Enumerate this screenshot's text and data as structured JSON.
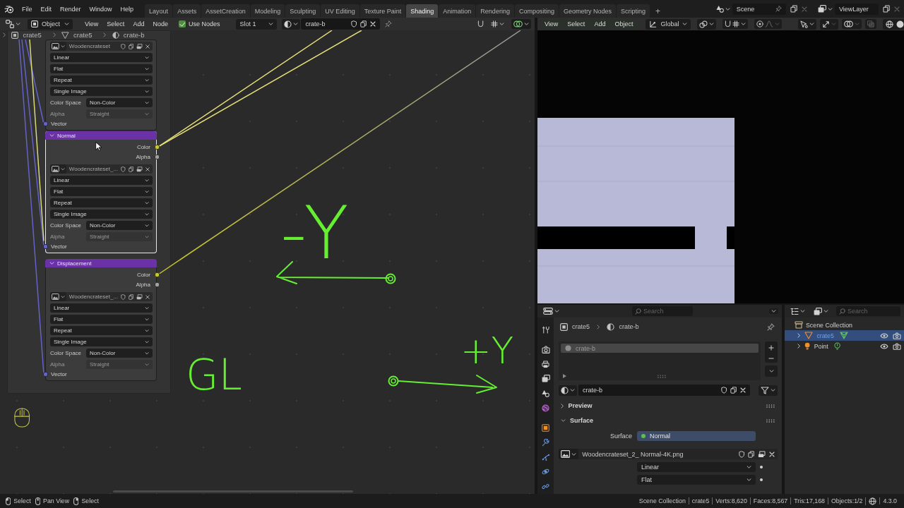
{
  "menu_bar": {
    "menus": [
      "File",
      "Edit",
      "Render",
      "Window",
      "Help"
    ],
    "workspaces": [
      {
        "label": "Layout",
        "selected": false
      },
      {
        "label": "Assets",
        "selected": false
      },
      {
        "label": "AssetCreation",
        "selected": false
      },
      {
        "label": "Modeling",
        "selected": false
      },
      {
        "label": "Sculpting",
        "selected": false
      },
      {
        "label": "UV Editing",
        "selected": false
      },
      {
        "label": "Texture Paint",
        "selected": false
      },
      {
        "label": "Shading",
        "selected": true
      },
      {
        "label": "Animation",
        "selected": false
      },
      {
        "label": "Rendering",
        "selected": false
      },
      {
        "label": "Compositing",
        "selected": false
      },
      {
        "label": "Geometry Nodes",
        "selected": false
      },
      {
        "label": "Scripting",
        "selected": false
      }
    ],
    "add_workspace": "+",
    "scene": "Scene",
    "view_layer": "ViewLayer"
  },
  "node_editor": {
    "header": {
      "mode": "Object",
      "menus": [
        "View",
        "Select",
        "Add",
        "Node"
      ],
      "use_nodes": {
        "label": "Use Nodes",
        "checked": true
      },
      "slot": "Slot 1",
      "material": "crate-b"
    },
    "breadcrumbs": [
      {
        "kind": "object",
        "label": "crate5"
      },
      {
        "kind": "mesh",
        "label": "crate5"
      },
      {
        "kind": "material",
        "label": "crate-b"
      }
    ],
    "nodes": [
      {
        "selected": false,
        "image": "Woodencrateset",
        "options": [
          "Linear",
          "Flat",
          "Repeat",
          "Single Image"
        ],
        "color_space": {
          "label": "Color Space",
          "value": "Non-Color"
        },
        "alpha": {
          "label": "Alpha",
          "value": "Straight",
          "disabled": true
        },
        "input": {
          "label": "Vector",
          "kind": "vector"
        }
      },
      {
        "title": "Normal",
        "selected": true,
        "outputs": [
          {
            "label": "Color",
            "kind": "color"
          },
          {
            "label": "Alpha",
            "kind": "float"
          }
        ],
        "image": "Woodencrateset_...",
        "options": [
          "Linear",
          "Flat",
          "Repeat",
          "Single Image"
        ],
        "color_space": {
          "label": "Color Space",
          "value": "Non-Color"
        },
        "alpha": {
          "label": "Alpha",
          "value": "Straight",
          "disabled": true
        },
        "input": {
          "label": "Vector",
          "kind": "vector"
        }
      },
      {
        "title": "Displacement",
        "selected": false,
        "outputs": [
          {
            "label": "Color",
            "kind": "color"
          },
          {
            "label": "Alpha",
            "kind": "float"
          }
        ],
        "image": "Woodencrateset_...",
        "options": [
          "Linear",
          "Flat",
          "Repeat",
          "Single Image"
        ],
        "color_space": {
          "label": "Color Space",
          "value": "Non-Color"
        },
        "alpha": {
          "label": "Alpha",
          "value": "Straight",
          "disabled": true
        },
        "input": {
          "label": "Vector",
          "kind": "vector"
        }
      }
    ],
    "annotations": [
      "-Y",
      "+Y",
      "GL"
    ]
  },
  "viewport": {
    "menus": [
      "View",
      "Select",
      "Add",
      "Object"
    ],
    "orientation": "Global"
  },
  "properties": {
    "search_placeholder": "Search",
    "breadcrumbs": [
      {
        "kind": "object",
        "label": "crate5"
      },
      {
        "kind": "material",
        "label": "crate-b"
      }
    ],
    "slots": [
      {
        "label": "crate-b",
        "selected": true
      }
    ],
    "material": "crate-b",
    "panels": [
      {
        "label": "Preview",
        "expanded": false
      },
      {
        "label": "Surface",
        "expanded": true
      }
    ],
    "surface": {
      "label": "Surface",
      "value": "Normal"
    },
    "image": "Woodencrateset_2_ Normal-4K.png",
    "options": [
      "Linear",
      "Flat"
    ]
  },
  "outliner": {
    "search_placeholder": "Search",
    "tree": [
      {
        "label": "Scene Collection",
        "kind": "collection",
        "children": [
          {
            "label": "crate5",
            "kind": "mesh",
            "selected": true,
            "expanded": false
          },
          {
            "label": "Point",
            "kind": "light",
            "selected": false,
            "expanded": false
          }
        ]
      }
    ]
  },
  "status_bar": {
    "hints": [
      {
        "kind": "left",
        "label": "Select"
      },
      {
        "kind": "middle",
        "label": "Pan View"
      },
      {
        "kind": "right",
        "label": "Select"
      }
    ],
    "stats": [
      "Scene Collection",
      "crate5",
      "Verts:8,620",
      "Faces:8,567",
      "Tris:17,168",
      "Objects:1/2"
    ],
    "version": "4.3.0"
  }
}
